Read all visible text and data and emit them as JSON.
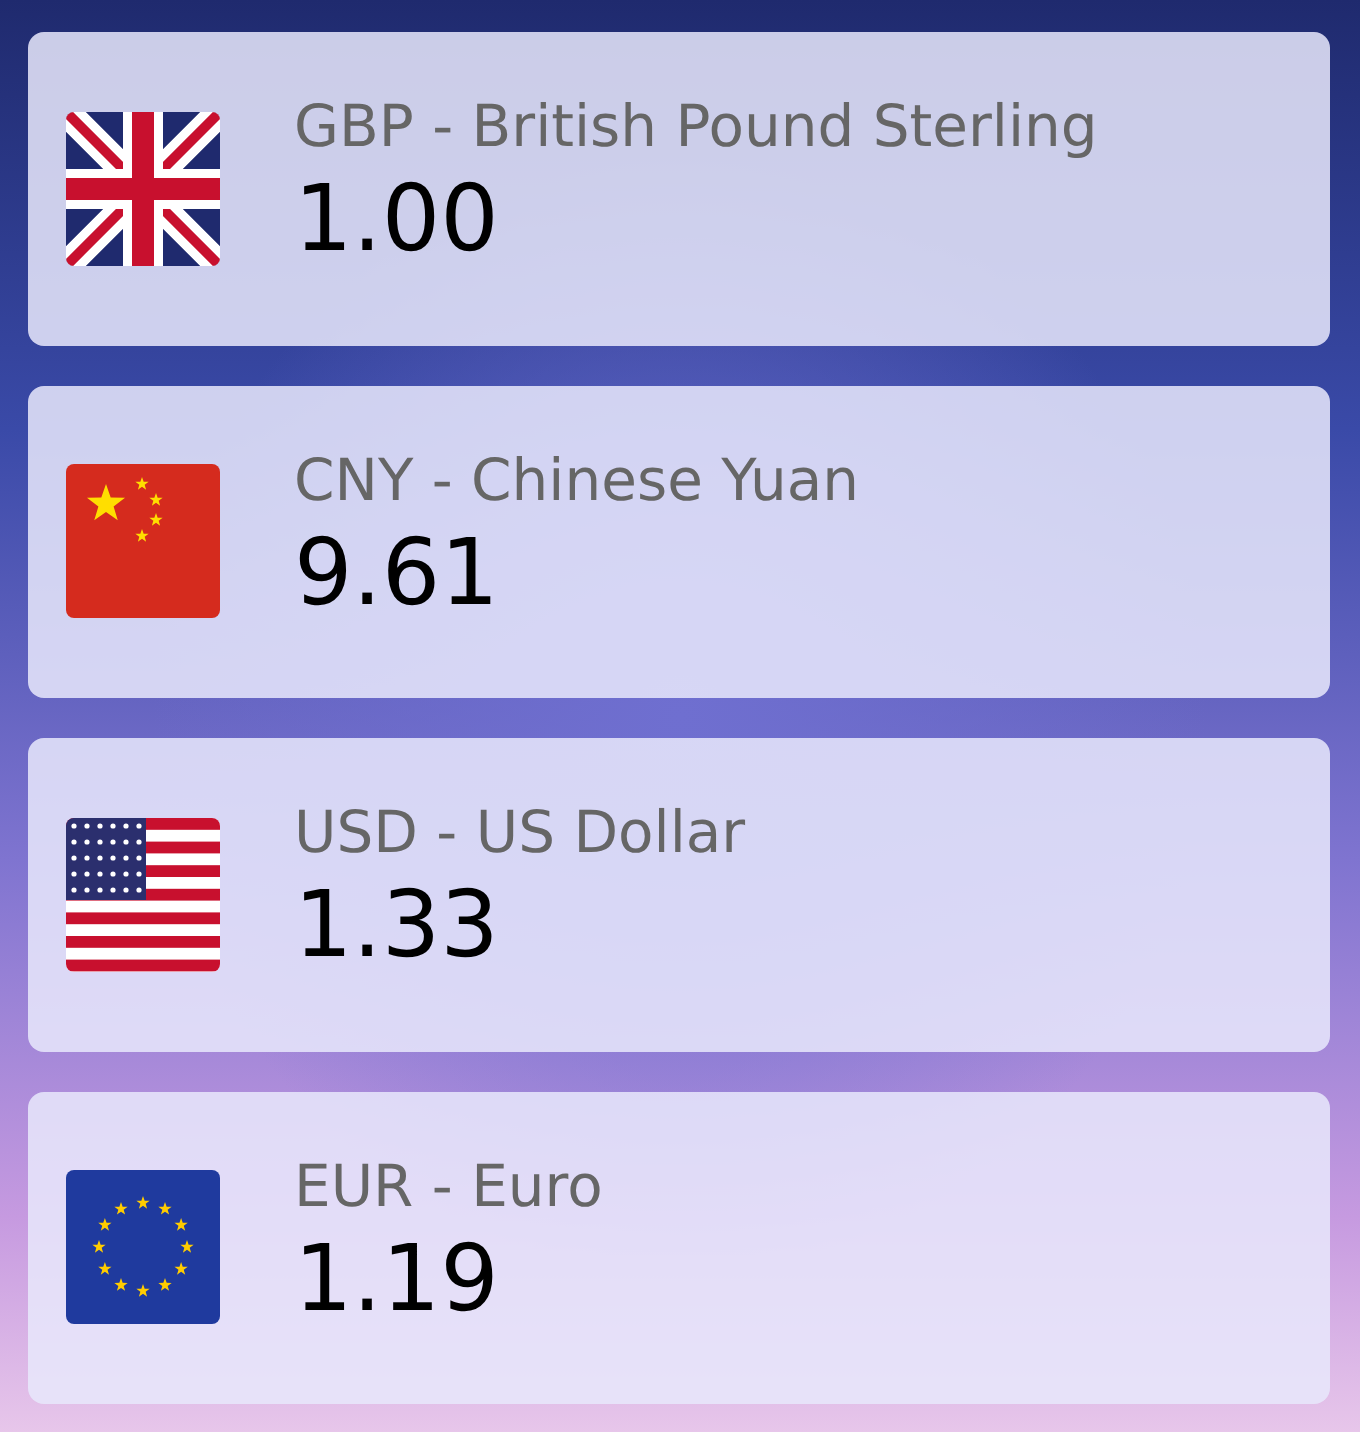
{
  "currencies": [
    {
      "kind": "gb",
      "name": "GBP - British Pound Sterling",
      "rate": "1.00"
    },
    {
      "kind": "cn",
      "name": "CNY - Chinese Yuan",
      "rate": "9.61"
    },
    {
      "kind": "us",
      "name": "USD - US Dollar",
      "rate": "1.33"
    },
    {
      "kind": "eu",
      "name": "EUR - Euro",
      "rate": "1.19"
    }
  ]
}
